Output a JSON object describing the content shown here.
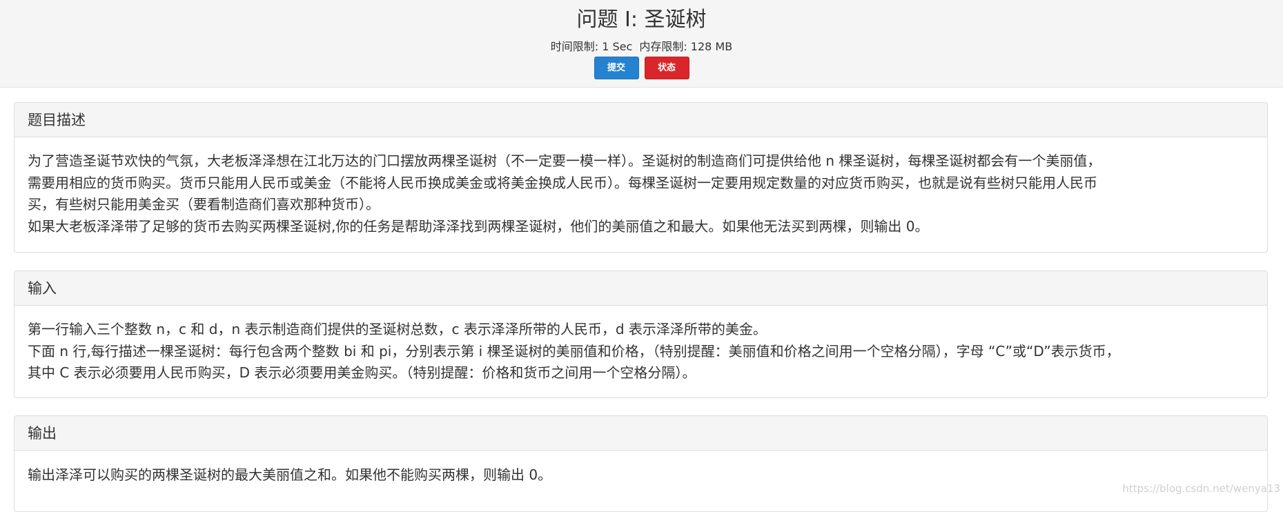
{
  "header": {
    "title": "问题 I: 圣诞树",
    "time_limit": "时间限制: 1 Sec",
    "memory_limit": "内存限制: 128 MB",
    "submit_label": "提交",
    "status_label": "状态",
    "submit_color": "#2582cf",
    "status_color": "#d9262b"
  },
  "sections": {
    "description": {
      "heading": "题目描述",
      "lines": [
        "为了营造圣诞节欢快的气氛，大老板泽泽想在江北万达的门口摆放两棵圣诞树（不一定要一模一样）。圣诞树的制造商们可提供给他 n 棵圣诞树，每棵圣诞树都会有一个美丽值，",
        "需要用相应的货币购买。货币只能用人民币或美金（不能将人民币换成美金或将美金换成人民币）。每棵圣诞树一定要用规定数量的对应货币购买，也就是说有些树只能用人民币",
        "买，有些树只能用美金买（要看制造商们喜欢那种货币）。",
        "如果大老板泽泽带了足够的货币去购买两棵圣诞树,你的任务是帮助泽泽找到两棵圣诞树，他们的美丽值之和最大。如果他无法买到两棵，则输出 0。"
      ]
    },
    "input": {
      "heading": "输入",
      "lines": [
        "第一行输入三个整数 n，c 和 d，n 表示制造商们提供的圣诞树总数，c 表示泽泽所带的人民币，d 表示泽泽所带的美金。",
        "下面 n 行,每行描述一棵圣诞树：每行包含两个整数 bi 和 pi，分别表示第 i 棵圣诞树的美丽值和价格，（特别提醒：美丽值和价格之间用一个空格分隔），字母 “C”或“D”表示货币，",
        "其中 C 表示必须要用人民币购买，D 表示必须要用美金购买。（特别提醒：价格和货币之间用一个空格分隔）。"
      ]
    },
    "output": {
      "heading": "输出",
      "lines": [
        "输出泽泽可以购买的两棵圣诞树的最大美丽值之和。如果他不能购买两棵，则输出 0。"
      ]
    }
  },
  "watermark": "https://blog.csdn.net/wenya13"
}
